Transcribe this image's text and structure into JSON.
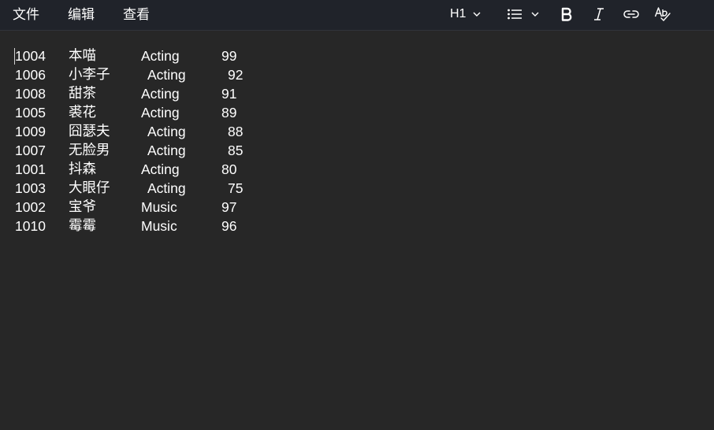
{
  "menu": {
    "file": "文件",
    "edit": "编辑",
    "view": "查看"
  },
  "toolbar": {
    "heading_label": "H1",
    "icons": [
      "chevron-down-icon",
      "bullet-list-icon",
      "bold-icon",
      "italic-icon",
      "link-icon",
      "spellcheck-icon"
    ]
  },
  "editor": {
    "rows": [
      {
        "id": "1004",
        "name": "本喵",
        "category": "Acting",
        "score": "99"
      },
      {
        "id": "1006",
        "name": "小李子",
        "category": "Acting",
        "score": "92"
      },
      {
        "id": "1008",
        "name": "甜茶",
        "category": "Acting",
        "score": "91"
      },
      {
        "id": "1005",
        "name": "裘花",
        "category": "Acting",
        "score": "89"
      },
      {
        "id": "1009",
        "name": "囧瑟夫",
        "category": "Acting",
        "score": "88"
      },
      {
        "id": "1007",
        "name": "无脸男",
        "category": "Acting",
        "score": "85"
      },
      {
        "id": "1001",
        "name": "抖森",
        "category": "Acting",
        "score": "80"
      },
      {
        "id": "1003",
        "name": "大眼仔",
        "category": "Acting",
        "score": "75"
      },
      {
        "id": "1002",
        "name": "宝爷",
        "category": "Music",
        "score": "97"
      },
      {
        "id": "1010",
        "name": "霉霉",
        "category": "Music",
        "score": "96"
      }
    ]
  },
  "colors": {
    "background": "#272727",
    "topbar": "#20232a",
    "text": "#ffffff"
  }
}
